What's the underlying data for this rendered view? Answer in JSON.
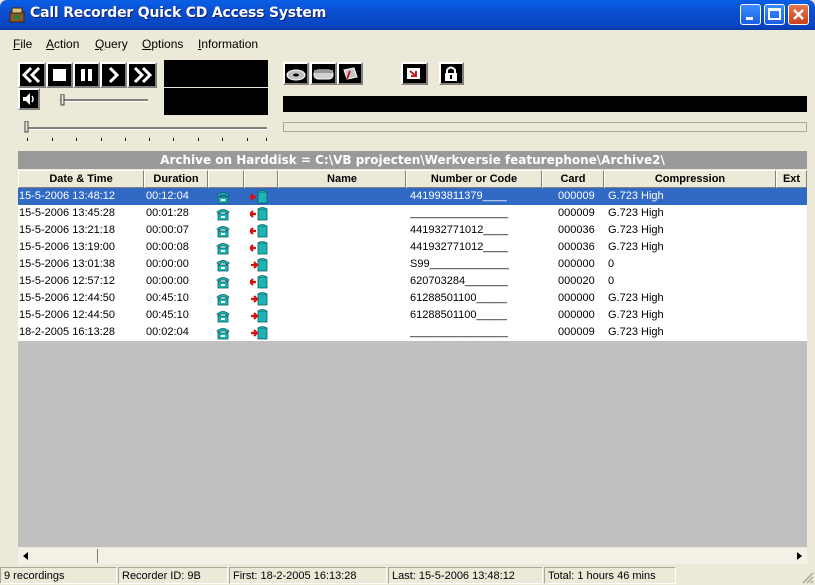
{
  "window": {
    "title": "Call Recorder Quick CD Access System"
  },
  "menu": [
    {
      "label": "File",
      "mnemonic": "F",
      "rest": "ile"
    },
    {
      "label": "Action",
      "mnemonic": "A",
      "rest": "ction"
    },
    {
      "label": "Query",
      "mnemonic": "Q",
      "rest": "uery"
    },
    {
      "label": "Options",
      "mnemonic": "O",
      "rest": "ptions"
    },
    {
      "label": "Information",
      "mnemonic": "I",
      "rest": "nformation"
    }
  ],
  "toolbar": {
    "transport_icons": [
      "rewind-icon",
      "stop-icon",
      "pause-icon",
      "play-icon",
      "fast-forward-icon"
    ],
    "action_icons": [
      "disc-icon",
      "drive-icon",
      "eraser-icon",
      "export-icon",
      "lock-icon"
    ],
    "volume_icon": "speaker-icon"
  },
  "archive": {
    "header": "Archive on Harddisk = C:\\VB projecten\\Werkversie featurephone\\Archive2\\"
  },
  "table": {
    "columns": [
      "Date & Time",
      "Duration",
      "",
      "",
      "Name",
      "Number or Code",
      "Card",
      "Compression",
      "Ext"
    ],
    "rows": [
      {
        "datetime": "15-5-2006 13:48:12",
        "duration": "00:12:04",
        "direction": "in",
        "name": "",
        "number": "441993811379____",
        "card": "000009",
        "compression": "G.723 High",
        "selected": true
      },
      {
        "datetime": "15-5-2006 13:45:28",
        "duration": "00:01:28",
        "direction": "in",
        "name": "",
        "number": "________________",
        "card": "000009",
        "compression": "G.723 High",
        "selected": false
      },
      {
        "datetime": "15-5-2006 13:21:18",
        "duration": "00:00:07",
        "direction": "in",
        "name": "",
        "number": "441932771012____",
        "card": "000036",
        "compression": "G.723 High",
        "selected": false
      },
      {
        "datetime": "15-5-2006 13:19:00",
        "duration": "00:00:08",
        "direction": "in",
        "name": "",
        "number": "441932771012____",
        "card": "000036",
        "compression": "G.723 High",
        "selected": false
      },
      {
        "datetime": "15-5-2006 13:01:38",
        "duration": "00:00:00",
        "direction": "out",
        "name": "",
        "number": "S99_____________",
        "card": "000000",
        "compression": "0",
        "selected": false
      },
      {
        "datetime": "15-5-2006 12:57:12",
        "duration": "00:00:00",
        "direction": "in",
        "name": "",
        "number": "620703284_______",
        "card": "000020",
        "compression": "0",
        "selected": false
      },
      {
        "datetime": "15-5-2006 12:44:50",
        "duration": "00:45:10",
        "direction": "out",
        "name": "",
        "number": "61288501100_____",
        "card": "000000",
        "compression": "G.723 High",
        "selected": false
      },
      {
        "datetime": "15-5-2006 12:44:50",
        "duration": "00:45:10",
        "direction": "out",
        "name": "",
        "number": "61288501100_____",
        "card": "000000",
        "compression": "G.723 High",
        "selected": false
      },
      {
        "datetime": "18-2-2005 16:13:28",
        "duration": "00:02:04",
        "direction": "out",
        "name": "",
        "number": "________________",
        "card": "000009",
        "compression": "G.723 High",
        "selected": false
      }
    ]
  },
  "status": {
    "count": "9 recordings",
    "recorder": "Recorder ID: 9B",
    "first": "First: 18-2-2005 16:13:28",
    "last": "Last: 15-5-2006 13:48:12",
    "total": "Total: 1 hours 46 mins"
  },
  "colors": {
    "selection": "#316ac5",
    "titlebar": "#0a5fe6",
    "grid_background": "#c0c0c0",
    "archive_header": "#9a9a9a"
  }
}
